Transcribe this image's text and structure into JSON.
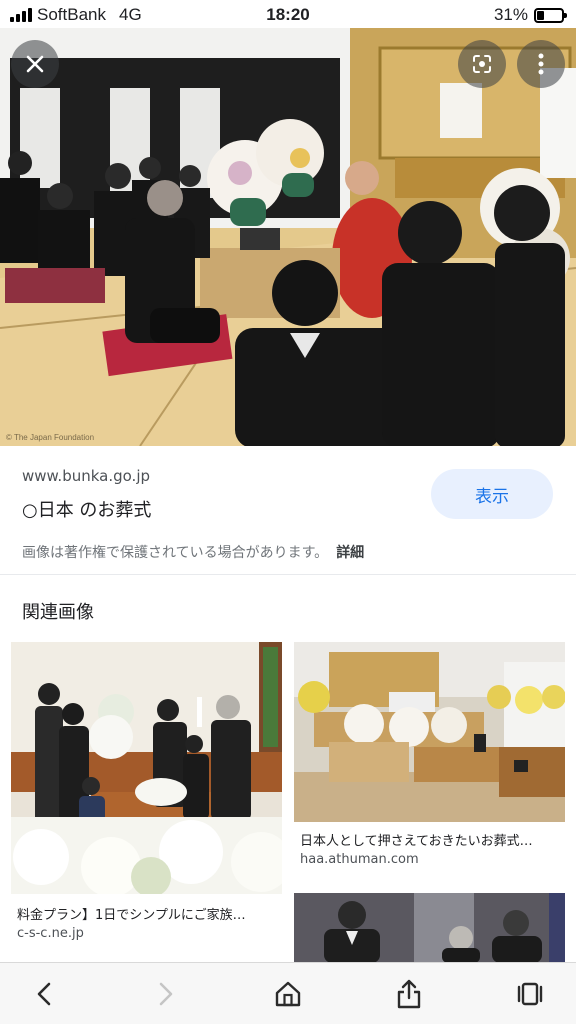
{
  "status": {
    "carrier": "SoftBank",
    "network": "4G",
    "time": "18:20",
    "battery": "31%",
    "battery_level": 0.31
  },
  "viewer": {
    "close_icon": "close-icon",
    "lens_icon": "google-lens-icon",
    "more_icon": "more-vertical-icon",
    "image_watermark": "© The Japan Foundation"
  },
  "source": {
    "domain": "www.bunka.go.jp",
    "title": "○日本 のお葬式",
    "view_button": "表示",
    "copyright_notice": "画像は著作権で保護されている場合があります。",
    "details_link": "詳細"
  },
  "related": {
    "heading": "関連画像",
    "items": [
      {
        "caption": "料金プラン】1日でシンプルにご家族…",
        "source": "c-s-c.ne.jp"
      },
      {
        "caption": "日本人として押さえておきたいお葬式…",
        "source": "haa.athuman.com"
      },
      {
        "caption": "",
        "source": ""
      }
    ]
  },
  "toolbar": {
    "back_icon": "chevron-left-icon",
    "forward_icon": "chevron-right-icon",
    "home_icon": "home-icon",
    "share_icon": "share-icon",
    "tabs_icon": "tabs-icon"
  }
}
